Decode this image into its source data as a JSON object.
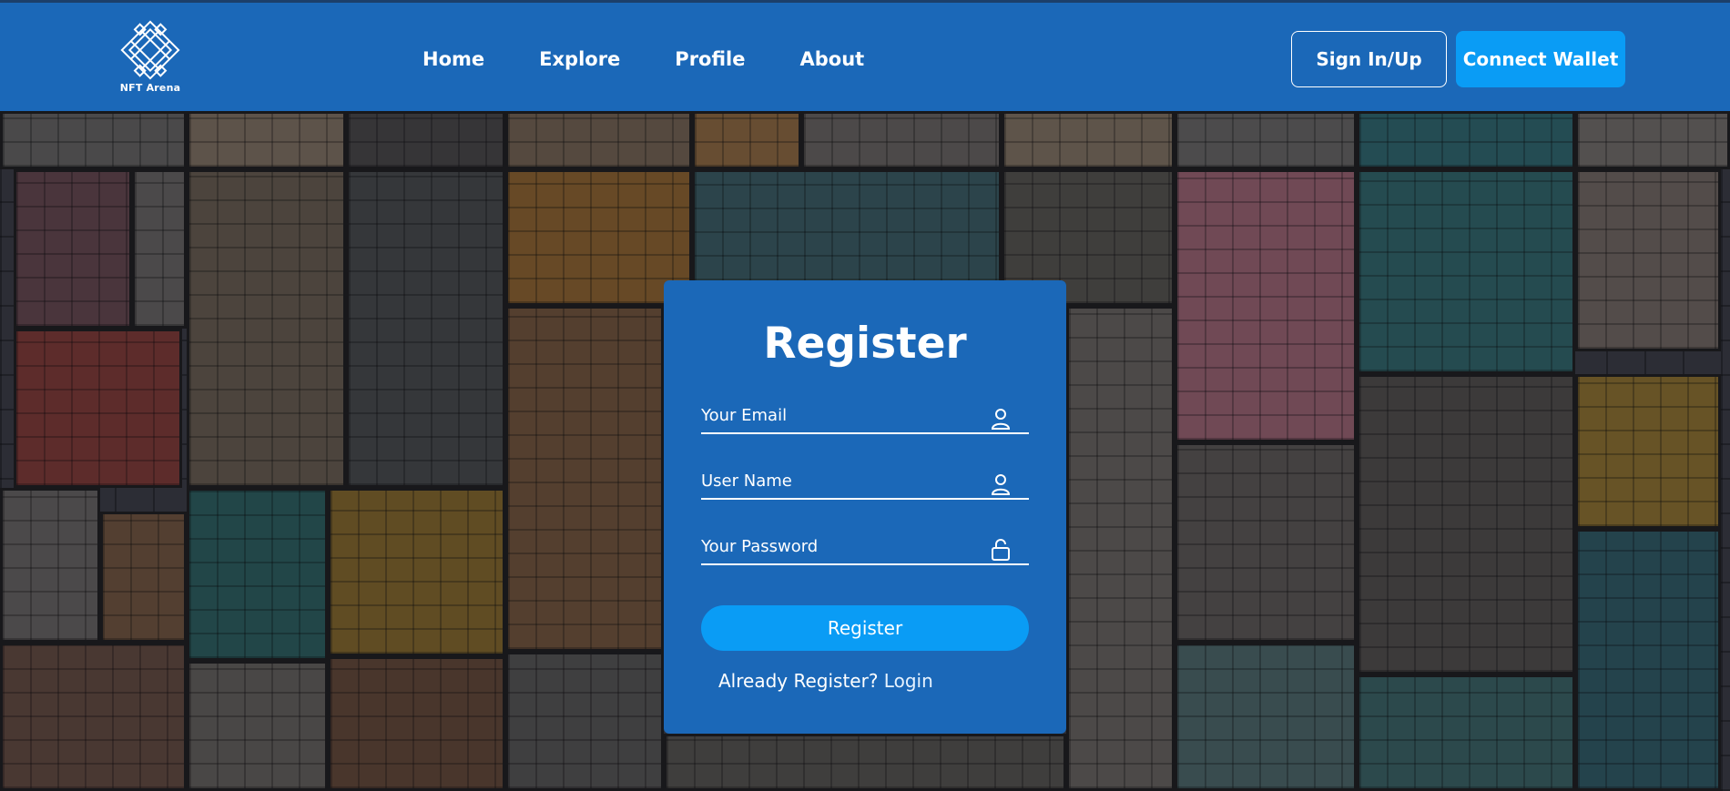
{
  "header": {
    "logo_text": "NFT Arena",
    "nav": [
      {
        "label": "Home"
      },
      {
        "label": "Explore"
      },
      {
        "label": "Profile"
      },
      {
        "label": "About"
      }
    ],
    "signin_label": "Sign In/Up",
    "wallet_label": "Connect Wallet"
  },
  "register": {
    "title": "Register",
    "email_placeholder": "Your Email",
    "username_placeholder": "User Name",
    "password_placeholder": "Your Password",
    "button_label": "Register",
    "login_prompt": "Already Register?",
    "login_link": "Login"
  },
  "colors": {
    "header_bg": "#1b68b8",
    "accent": "#0a9cf5",
    "card_bg": "#1b68b8"
  },
  "icons": {
    "logo": "knot-logo-icon",
    "email": "user-icon",
    "username": "user-icon",
    "password": "unlock-icon"
  }
}
